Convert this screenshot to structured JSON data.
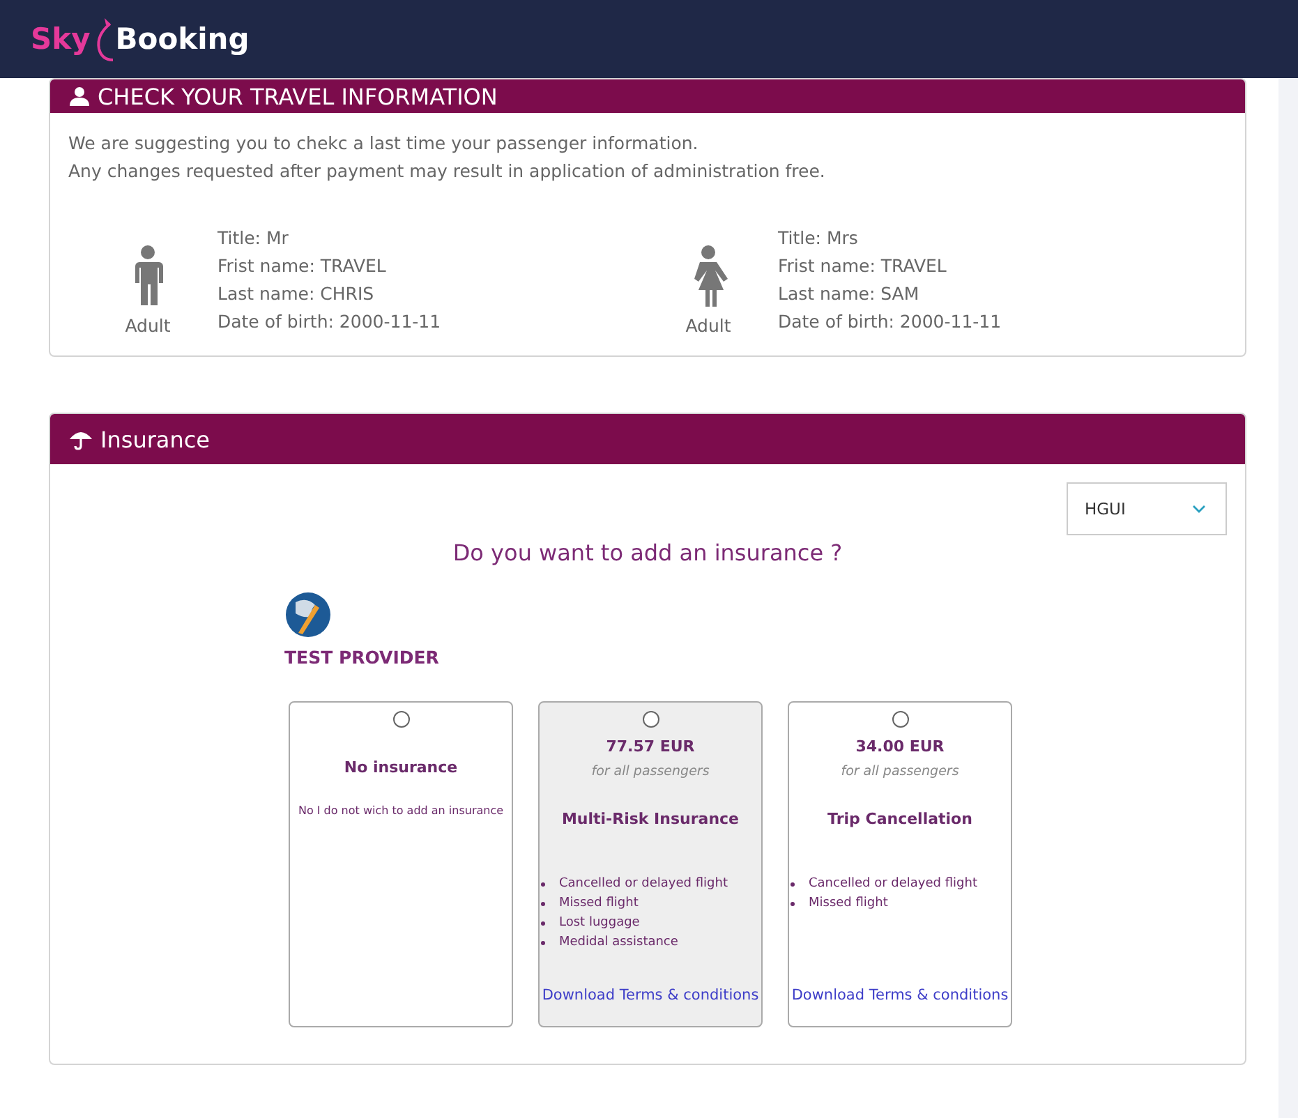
{
  "brand": {
    "part_1": "Sky",
    "part_2": "Booking"
  },
  "travel": {
    "title": "CHECK YOUR TRAVEL INFORMATION",
    "intro": [
      "We are suggesting you to chekc a last time your passenger information.",
      "Any changes requested after payment may result in application of administration free."
    ],
    "passengers": [
      {
        "kind": "male",
        "type": "Adult",
        "lines": [
          "Title: Mr",
          "Frist name: TRAVEL",
          "Last name: CHRIS",
          "Date of birth: 2000-11-11"
        ]
      },
      {
        "kind": "female",
        "type": "Adult",
        "lines": [
          "Title: Mrs",
          "Frist name: TRAVEL",
          "Last name: SAM",
          "Date of birth: 2000-11-11"
        ]
      }
    ]
  },
  "insurance": {
    "title": "Insurance",
    "select": {
      "value": "HGUI"
    },
    "question": "Do you want to add an insurance ?",
    "provider": "TEST PROVIDER",
    "options": [
      {
        "selected": false,
        "highlighted": false,
        "name": "No insurance",
        "description": "No I do not wich to add an insurance"
      },
      {
        "selected": false,
        "highlighted": true,
        "price": "77.57 EUR",
        "price_note": "for all passengers",
        "name": "Multi-Risk Insurance",
        "features": [
          "Cancelled or delayed flight",
          "Missed flight",
          "Lost luggage",
          "Medidal assistance"
        ],
        "link": "Download Terms & conditions"
      },
      {
        "selected": false,
        "highlighted": false,
        "price": "34.00 EUR",
        "price_note": "for all passengers",
        "name": "Trip Cancellation",
        "features": [
          "Cancelled or delayed flight",
          "Missed flight"
        ],
        "link": "Download Terms & conditions"
      }
    ]
  }
}
